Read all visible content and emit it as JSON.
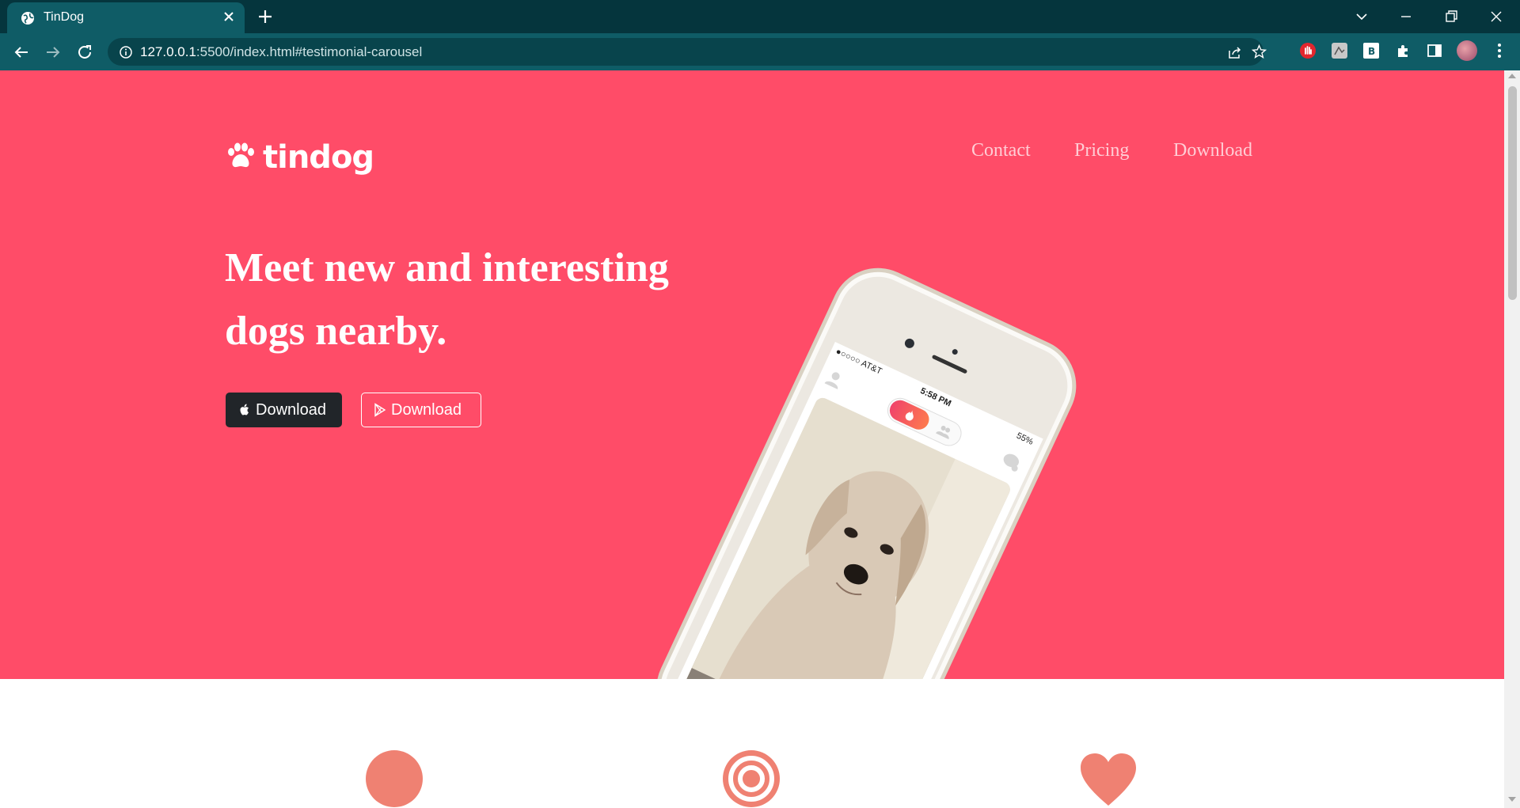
{
  "browser": {
    "tab_title": "TinDog",
    "url_host": "127.0.0.1",
    "url_rest": ":5500/index.html#testimonial-carousel",
    "icons": [
      "globe-icon",
      "close-icon",
      "plus-icon",
      "chevron-down-icon",
      "minimize-icon",
      "restore-icon",
      "close-window-icon",
      "back-icon",
      "forward-icon",
      "reload-icon",
      "info-icon",
      "share-icon",
      "star-icon",
      "extension-icons",
      "puzzle-icon",
      "sidebar-icon",
      "avatar",
      "kebab-menu-icon"
    ]
  },
  "brand": {
    "name": "tindog"
  },
  "nav": {
    "contact": "Contact",
    "pricing": "Pricing",
    "download": "Download"
  },
  "hero": {
    "headline": "Meet new and interesting dogs nearby.",
    "apple_button": "Download",
    "play_button": "Download",
    "background_color": "#ff4c68"
  },
  "phone": {
    "carrier": "●○○○○ AT&T",
    "time": "5:58 PM",
    "battery": "55%"
  },
  "features": {
    "icons": [
      "check-icon",
      "target-icon",
      "heart-icon"
    ],
    "accent_color": "#ef8172"
  }
}
